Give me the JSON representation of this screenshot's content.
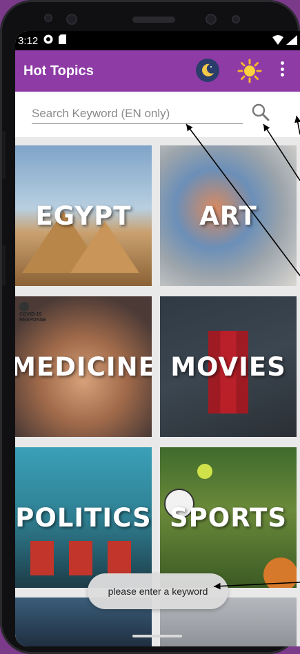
{
  "status_bar": {
    "time": "3:12"
  },
  "app_bar": {
    "title": "Hot Topics",
    "colors": {
      "primary": "#8e3ba6"
    }
  },
  "search": {
    "placeholder": "Search Keyword (EN only)",
    "value": ""
  },
  "topics": [
    {
      "label": "EGYPT"
    },
    {
      "label": "ART"
    },
    {
      "label": "MEDICINE"
    },
    {
      "label": "MOVIES"
    },
    {
      "label": "POLITICS"
    },
    {
      "label": "SPORTS"
    }
  ],
  "medicine_badge": {
    "line1": "COVID-19",
    "line2": "RESPONSE"
  },
  "toast": {
    "message": "please enter a keyword"
  },
  "icons": {
    "night_mode": "moon-icon",
    "day_mode": "sun-icon",
    "menu": "more-vertical-icon",
    "search": "search-icon"
  }
}
